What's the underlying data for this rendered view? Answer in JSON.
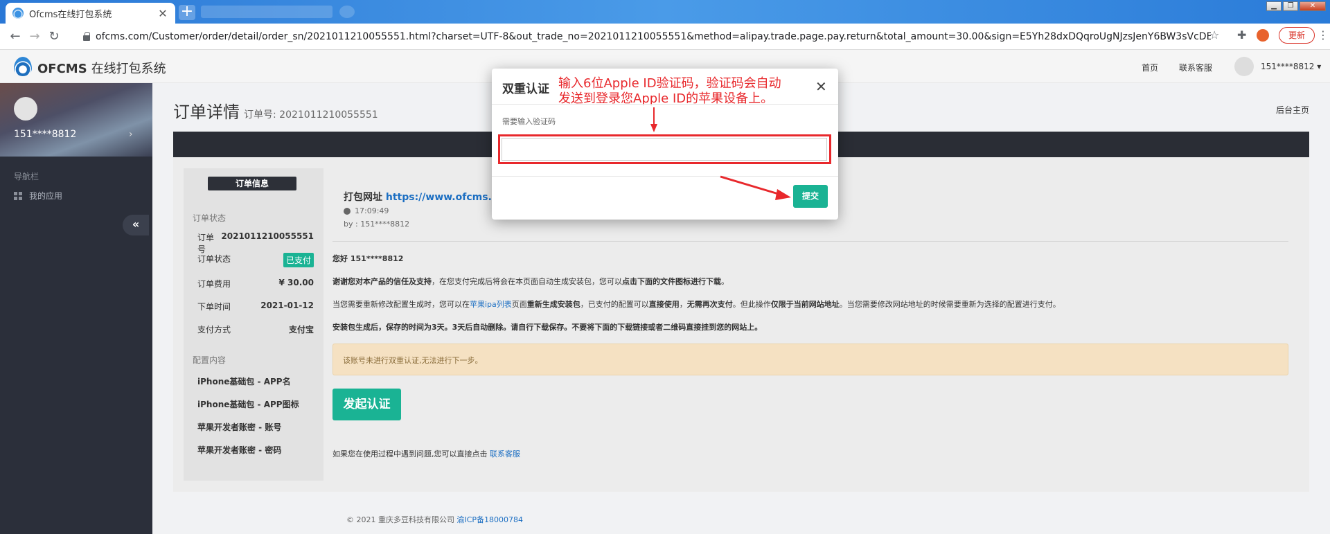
{
  "browser": {
    "tab_title": "Ofcms在线打包系统",
    "url": "ofcms.com/Customer/order/detail/order_sn/2021011210055551.html?charset=UTF-8&out_trade_no=2021011210055551&method=alipay.trade.page.pay.return&total_amount=30.00&sign=E5Yh28dxDQqroUgNJzsJenY6BW3sVcDEYkYS...",
    "update_label": "更新"
  },
  "header": {
    "logo_name": "OFCMS",
    "logo_sub": "在线打包系统",
    "nav_home": "首页",
    "nav_support": "联系客服",
    "user": "151****8812"
  },
  "sidebar": {
    "user": "151****8812",
    "nav_title": "导航栏",
    "item_apps": "我的应用"
  },
  "page": {
    "title": "订单详情",
    "order_no_label": "订单号: 2021011210055551",
    "back_link": "后台主页"
  },
  "order_info": {
    "tag": "订单信息",
    "status_section": "订单状态",
    "rows": [
      {
        "label": "订单号",
        "value": "2021011210055551"
      },
      {
        "label": "订单状态",
        "value": "已支付"
      },
      {
        "label": "订单费用",
        "value": "¥ 30.00"
      },
      {
        "label": "下单时间",
        "value": "2021-01-12"
      },
      {
        "label": "支付方式",
        "value": "支付宝"
      }
    ],
    "config_section": "配置内容",
    "config_items": [
      "iPhone基础包 - APP名",
      "iPhone基础包 - APP图标",
      "苹果开发者账密 - 账号",
      "苹果开发者账密 - 密码"
    ]
  },
  "detail": {
    "pack_label": "打包网址",
    "pack_url": "https://www.ofcms.cc",
    "time": "17:09:49",
    "by": "by : 151****8812",
    "greeting": "您好 151****8812",
    "p1_bold": "谢谢您对本产品的信任及支持",
    "p1_rest": "，在您支付完成后将会在本页面自动生成安装包，您可以",
    "p1_bold2": "点击下面的文件图标进行下载",
    "p1_end": "。",
    "p2_a": "当您需要重新修改配置生成时，您可以在",
    "p2_link": "苹果ipa列表",
    "p2_b": "页面",
    "p2_bold1": "重新生成安装包",
    "p2_c": "，已支付的配置可以",
    "p2_bold2": "直接使用",
    "p2_d": "，",
    "p2_bold3": "无需再次支付",
    "p2_e": "。但此操作",
    "p2_bold4": "仅限于当前网站地址",
    "p2_f": "。当您需要修改网站地址的时候需要重新为选择的配置进行支付。",
    "p3": "安装包生成后，保存的时间为3天。3天后自动删除。请自行下载保存。不要将下面的下载链接或者二维码直接挂到您的网站上。",
    "warning": "该账号未进行双重认证,无法进行下一步。",
    "auth_button": "发起认证",
    "help_text": "如果您在使用过程中遇到问题,您可以直接点击",
    "help_link": "联系客服"
  },
  "footer": {
    "copyright": "© 2021 重庆多豆科技有限公司",
    "icp": "渝ICP备18000784"
  },
  "modal": {
    "title": "双重认证",
    "label": "需要输入验证码",
    "input_value": "",
    "submit": "提交",
    "annotation_line1": "输入6位Apple ID验证码，验证码会自动",
    "annotation_line2": "发送到登录您Apple ID的苹果设备上。"
  },
  "colors": {
    "accent": "#1ab394",
    "annotation_red": "#e8282c",
    "sidebar_bg": "#2b2f3a"
  }
}
